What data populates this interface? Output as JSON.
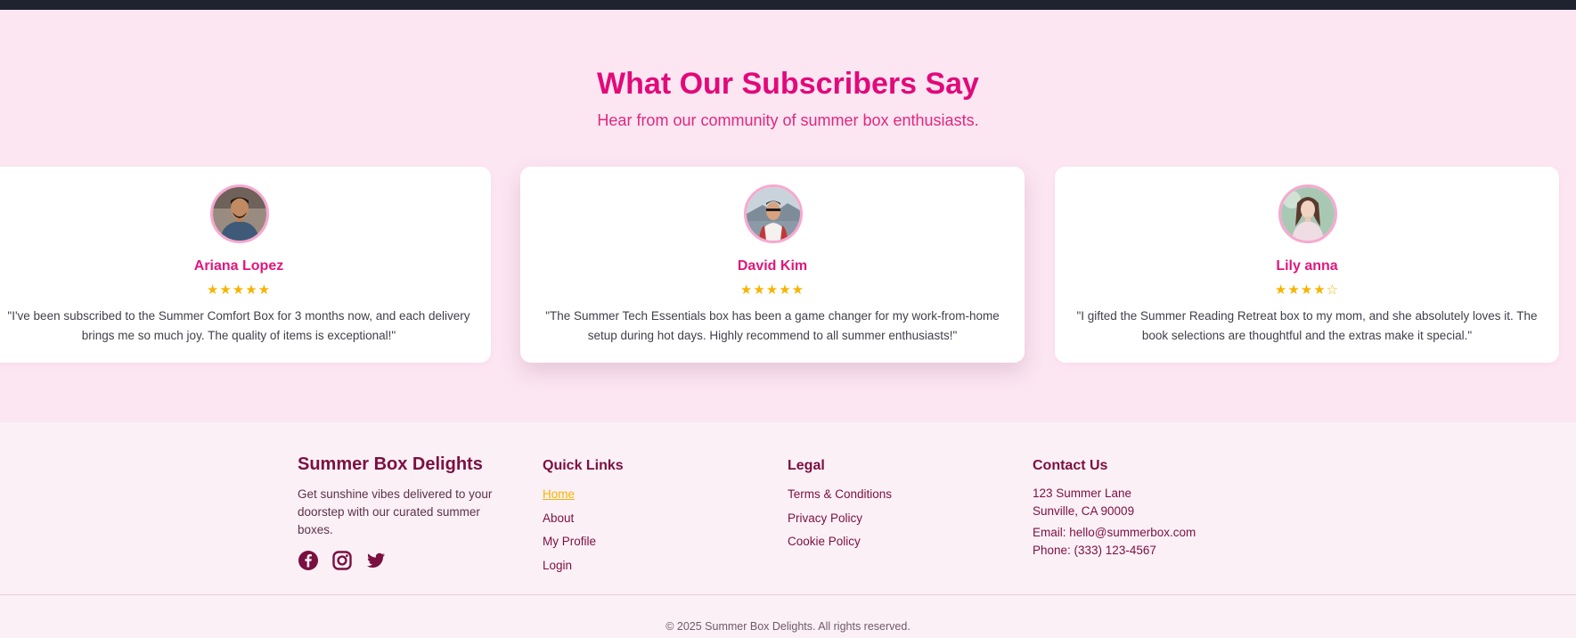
{
  "testimonials": {
    "title": "What Our Subscribers Say",
    "subtitle": "Hear from our community of summer box enthusiasts.",
    "cards": [
      {
        "name": "Ariana Lopez",
        "stars": "★★★★★",
        "rating": 5,
        "quote": "\"I've been subscribed to the Summer Comfort Box for 3 months now, and each delivery brings me so much joy. The quality of items is exceptional!\""
      },
      {
        "name": "David Kim",
        "stars": "★★★★★",
        "rating": 5,
        "quote": "\"The Summer Tech Essentials box has been a game changer for my work-from-home setup during hot days. Highly recommend to all summer enthusiasts!\""
      },
      {
        "name": "Lily anna",
        "stars": "★★★★☆",
        "rating": 4,
        "quote": "\"I gifted the Summer Reading Retreat box to my mom, and she absolutely loves it. The book selections are thoughtful and the extras make it special.\""
      }
    ]
  },
  "footer": {
    "brand": {
      "title": "Summer Box Delights",
      "description": "Get sunshine vibes delivered to your doorstep with our curated summer boxes.",
      "socials": [
        "facebook-icon",
        "instagram-icon",
        "twitter-icon"
      ]
    },
    "quick_links": {
      "title": "Quick Links",
      "items": [
        "Home",
        "About",
        "My Profile",
        "Login"
      ],
      "active": "Home"
    },
    "legal": {
      "title": "Legal",
      "items": [
        "Terms & Conditions",
        "Privacy Policy",
        "Cookie Policy"
      ]
    },
    "contact": {
      "title": "Contact Us",
      "address_line1": "123 Summer Lane",
      "address_line2": "Sunville, CA 90009",
      "email": "Email: hello@summerbox.com",
      "phone": "Phone: (333) 123-4567"
    },
    "copyright": "© 2025 Summer Box Delights. All rights reserved."
  },
  "colors": {
    "accent_pink": "#e2097a",
    "dark_maroon": "#7a1040",
    "star_gold": "#f6b400",
    "section_bg": "#fce6f2",
    "footer_bg": "#fcf0f7"
  }
}
